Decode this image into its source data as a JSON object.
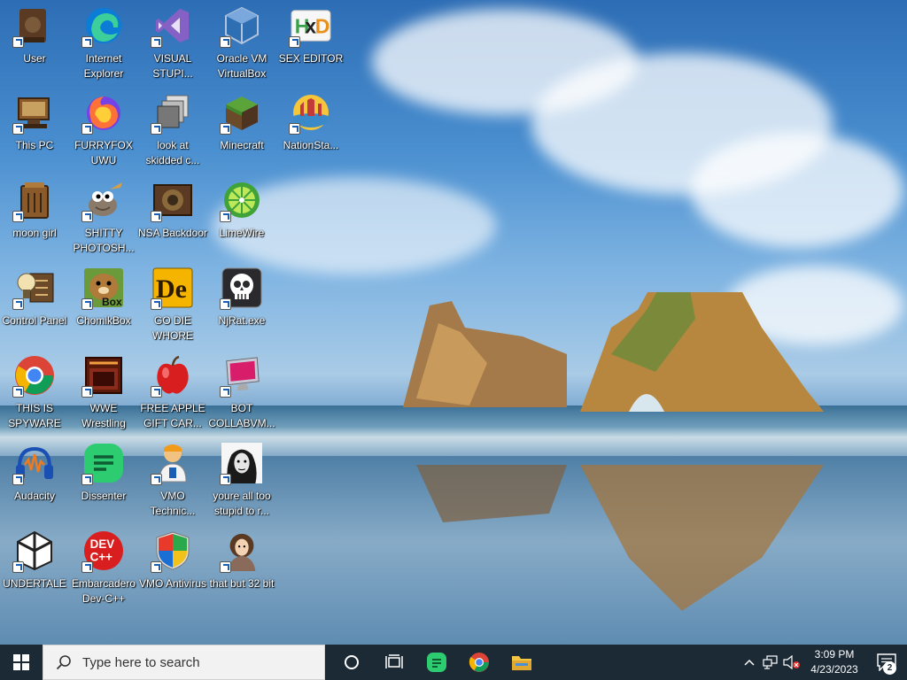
{
  "desktop": {
    "icons": [
      {
        "label": "User",
        "icon": "user-folder-icon"
      },
      {
        "label": "Internet Explorer",
        "icon": "edge-icon"
      },
      {
        "label": "VISUAL STUPI...",
        "icon": "visual-studio-icon"
      },
      {
        "label": "Oracle VM VirtualBox",
        "icon": "virtualbox-icon"
      },
      {
        "label": "SEX EDITOR",
        "icon": "hxd-icon"
      },
      {
        "label": "This PC",
        "icon": "this-pc-icon"
      },
      {
        "label": "FURRYFOX UWU",
        "icon": "firefox-icon"
      },
      {
        "label": "look at skidded c...",
        "icon": "stack-windows-icon"
      },
      {
        "label": "Minecraft",
        "icon": "minecraft-icon"
      },
      {
        "label": "NationSta...",
        "icon": "nationstates-icon"
      },
      {
        "label": "moon girl",
        "icon": "recycle-bin-icon"
      },
      {
        "label": "SHITTY PHOTOSH...",
        "icon": "gimp-icon"
      },
      {
        "label": "NSA Backdoor",
        "icon": "nsa-folder-icon"
      },
      {
        "label": "LimeWire",
        "icon": "limewire-icon"
      },
      {
        "label": "Control Panel",
        "icon": "control-panel-icon"
      },
      {
        "label": "ChomikBox",
        "icon": "chomikbox-icon"
      },
      {
        "label": "GO DIE WHORE",
        "icon": "de-icon"
      },
      {
        "label": "NjRat.exe",
        "icon": "skull-icon"
      },
      {
        "label": "THIS IS SPYWARE",
        "icon": "chrome-icon"
      },
      {
        "label": "WWE Wrestling",
        "icon": "wrestling-icon"
      },
      {
        "label": "FREE APPLE GIFT CAR...",
        "icon": "apple-icon"
      },
      {
        "label": "BOT COLLABVM...",
        "icon": "monitor-icon"
      },
      {
        "label": "Audacity",
        "icon": "audacity-icon"
      },
      {
        "label": "Dissenter",
        "icon": "dissenter-icon"
      },
      {
        "label": "VMO Technic...",
        "icon": "technician-icon"
      },
      {
        "label": "youre all too stupid to r...",
        "icon": "portrait-icon"
      },
      {
        "label": "UNDERTALE",
        "icon": "unity-icon"
      },
      {
        "label": "Embarcadero Dev-C++",
        "icon": "devcpp-icon"
      },
      {
        "label": "VMO Antivirus",
        "icon": "shield-icon"
      },
      {
        "label": "that but 32 bit",
        "icon": "portrait-woman-icon"
      }
    ]
  },
  "taskbar": {
    "search_placeholder": "Type here to search",
    "time": "3:09 PM",
    "date": "4/23/2023",
    "notification_count": "2"
  },
  "colors": {
    "taskbar_bg": "#1c2a36",
    "accent": "#1a5fb4"
  }
}
